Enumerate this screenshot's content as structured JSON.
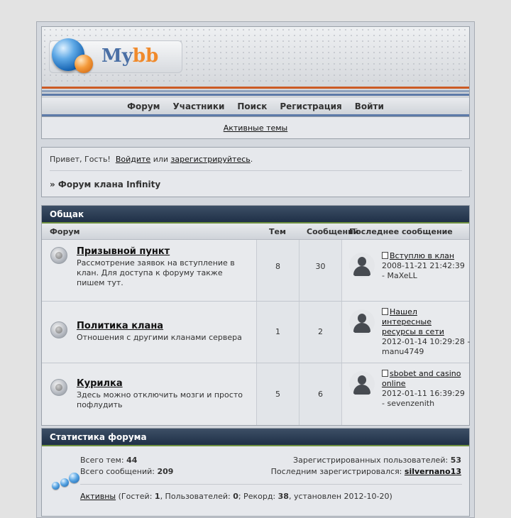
{
  "logo": {
    "my": "My",
    "bb": "bb"
  },
  "nav": [
    "Форум",
    "Участники",
    "Поиск",
    "Регистрация",
    "Войти"
  ],
  "subnav": {
    "active_topics": "Активные темы"
  },
  "welcome": {
    "greeting": "Привет, Гость!",
    "login_link": "Войдите",
    "or": "или",
    "register_link": "зарегистрируйтесь",
    "period": ".",
    "breadcrumb": "» Форум клана Infinity"
  },
  "category": {
    "title": "Общак",
    "columns": {
      "forum": "Форум",
      "topics": "Тем",
      "posts": "Сообщений",
      "last_post": "Последнее сообщение"
    },
    "forums": [
      {
        "title": "Призывной пункт",
        "desc": "Рассмотрение заявок на вступление в клан. Для доступа к форуму также пишем тут.",
        "topics": "8",
        "posts": "30",
        "last_title": "Вступлю в клан",
        "last_meta": "2008-11-21 21:42:39 - MaXeLL"
      },
      {
        "title": "Политика клана",
        "desc": "Отношения с другими кланами сервера",
        "topics": "1",
        "posts": "2",
        "last_title": "Нашел интересные ресурсы в сети",
        "last_meta": "2012-01-14 10:29:28 - manu4749"
      },
      {
        "title": "Курилка",
        "desc": "Здесь можно отключить мозги и просто пофлудить",
        "topics": "5",
        "posts": "6",
        "last_title": "sbobet and casino online",
        "last_meta": "2012-01-11 16:39:29 - sevenzenith"
      }
    ]
  },
  "stats": {
    "title": "Статистика форума",
    "total_topics_label": "Всего тем:",
    "total_topics": "44",
    "total_posts_label": "Всего сообщений:",
    "total_posts": "209",
    "registered_label": "Зарегистрированных пользователей:",
    "registered": "53",
    "last_registered_label": "Последним зарегистрировался:",
    "last_registered": "silvernano13",
    "active_link": "Активны",
    "guests_label": "(Гостей:",
    "guests": "1",
    "users_label": ", Пользователей:",
    "users": "0",
    "record_label": "; Рекорд:",
    "record": "38",
    "record_date": ", установлен 2012-10-20)"
  }
}
